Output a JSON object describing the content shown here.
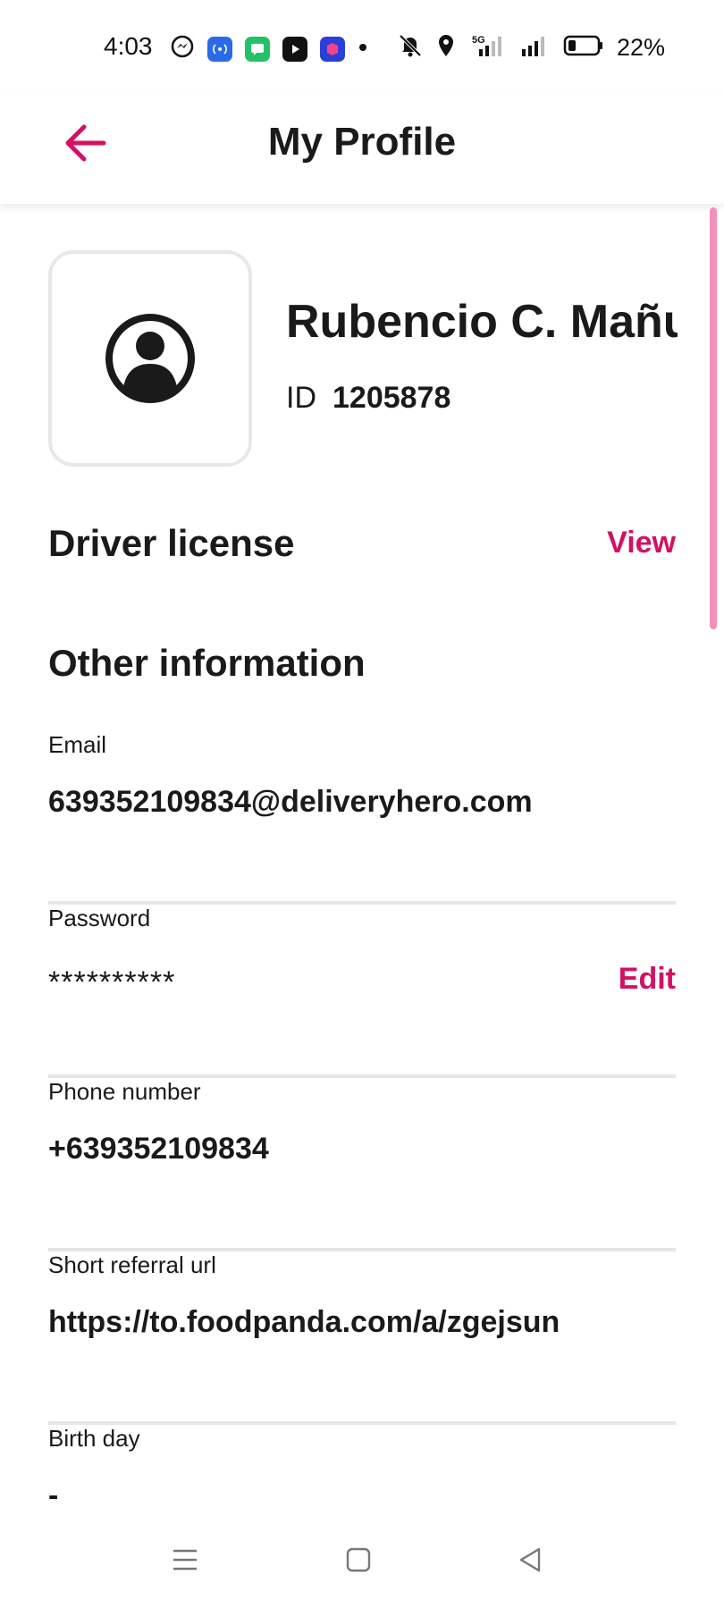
{
  "status_bar": {
    "time": "4:03",
    "battery_percent": "22%",
    "network": "5G"
  },
  "header": {
    "title": "My Profile"
  },
  "profile": {
    "name": "Rubencio C. Mañuz",
    "id_label": "ID",
    "id_value": "1205878"
  },
  "driver_license": {
    "title": "Driver license",
    "action_label": "View"
  },
  "other_information": {
    "title": "Other information",
    "fields": [
      {
        "label": "Email",
        "value": "639352109834@deliveryhero.com"
      },
      {
        "label": "Password",
        "value": "**********",
        "action_label": "Edit"
      },
      {
        "label": "Phone number",
        "value": "+639352109834"
      },
      {
        "label": "Short referral url",
        "value": "https://to.foodpanda.com/a/zgejsun"
      },
      {
        "label": "Birth day",
        "value": "-"
      }
    ]
  },
  "colors": {
    "accent": "#d31162",
    "scroll_thumb": "#f48fb8",
    "divider": "#e6e6e6"
  }
}
